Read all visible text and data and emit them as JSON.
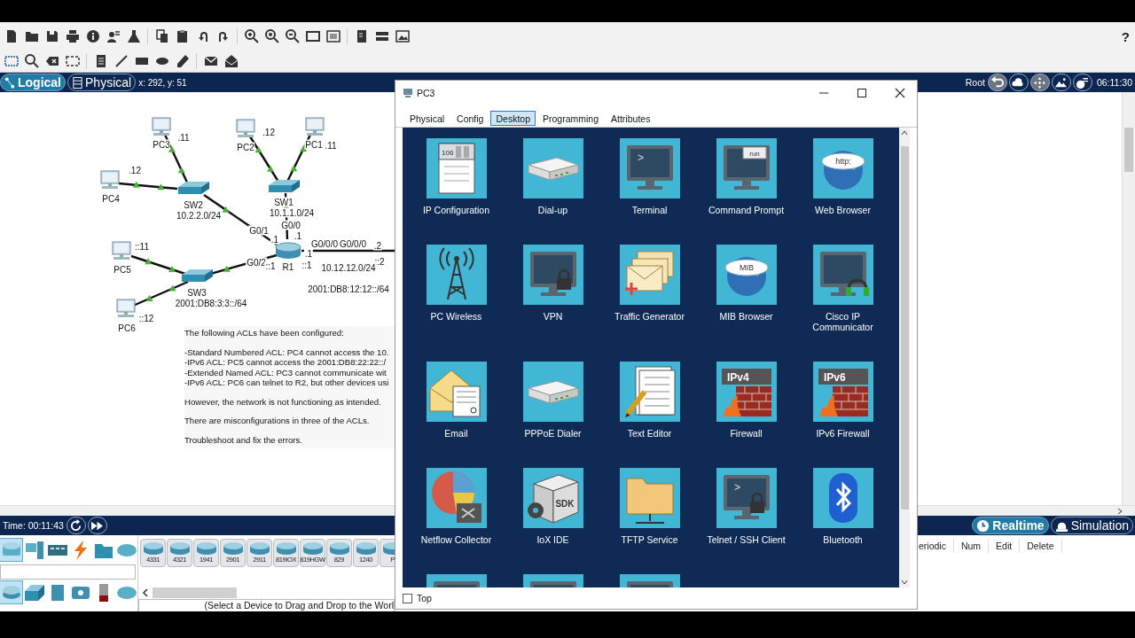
{
  "toolbar": {
    "help": "?"
  },
  "nav": {
    "tabs": [
      {
        "label": "Logical",
        "selected": true
      },
      {
        "label": "Physical",
        "selected": false
      }
    ],
    "coords": "x: 292, y: 51",
    "root": "Root",
    "clock": "06:11:30"
  },
  "topology": {
    "devices": [
      {
        "kind": "pc"
      },
      {
        "kind": "pc"
      },
      {
        "kind": "pc"
      },
      {
        "kind": "pc"
      },
      {
        "kind": "switch"
      },
      {
        "kind": "switch"
      },
      {
        "kind": "router"
      },
      {
        "kind": "pc"
      },
      {
        "kind": "switch"
      },
      {
        "kind": "pc"
      }
    ],
    "labels": [
      ".11",
      "PC3",
      ".12",
      "PC2",
      "PC1",
      ".11",
      ".12",
      "PC4",
      "SW2",
      "10.2.2.0/24",
      "SW1",
      "10.1.1.0/24",
      "G0/1",
      "G0/0",
      ".1",
      ".1",
      "G0/0/0",
      "G0/0/0",
      ".1",
      ".2",
      "G0/2",
      "::1",
      "R1",
      "::1",
      "::2",
      "10.12.12.0/24",
      "2001:DB8:12:12::/64",
      "::11",
      "PC5",
      "SW3",
      "2001:DB8:3:3::/64",
      "PC6",
      "::12"
    ]
  },
  "notes": [
    [
      "The following ACLs have been configured:"
    ],
    [
      "-Standard Numbered ACL: PC4 cannot access the 10.",
      "-IPv6 ACL: PC5 cannot access the 2001:DB8:22:22::/",
      "-Extended Named ACL: PC3 cannot communicate wit",
      "-IPv6 ACL: PC6 can telnet to R2, but other devices usi"
    ],
    [
      "However, the network is not functioning as intended."
    ],
    [
      "There are misconfigurations in three of the ACLs."
    ],
    [
      "Troubleshoot and fix the errors."
    ]
  ],
  "sim_bar": {
    "time": "Time: 00:11:43",
    "modes": [
      {
        "label": "Realtime",
        "selected": true
      },
      {
        "label": "Simulation",
        "selected": false
      }
    ]
  },
  "device_panel": {
    "categories_top": [
      {
        "selected": true
      },
      {
        "selected": false
      },
      {
        "selected": false
      },
      {
        "selected": false
      },
      {
        "selected": false
      },
      {
        "selected": false
      }
    ],
    "categories_bottom": [
      {
        "selected": true
      },
      {
        "selected": false
      },
      {
        "selected": false
      },
      {
        "selected": false
      },
      {
        "selected": false
      },
      {
        "selected": false
      }
    ],
    "models": [
      "4331",
      "4321",
      "1941",
      "2901",
      "2911",
      "819IOX",
      "819HGW",
      "829",
      "1240",
      "P"
    ],
    "hint": "(Select a Device to Drag and Drop to the Worl"
  },
  "scenario_table": {
    "columns": [
      "eriodic",
      "Num",
      "Edit",
      "Delete"
    ]
  },
  "window": {
    "title": "PC3",
    "tabs": [
      {
        "label": "Physical",
        "selected": false
      },
      {
        "label": "Config",
        "selected": false
      },
      {
        "label": "Desktop",
        "selected": true
      },
      {
        "label": "Programming",
        "selected": false
      },
      {
        "label": "Attributes",
        "selected": false
      }
    ],
    "apps": [
      {
        "label": "IP Configuration",
        "icon_text": "106"
      },
      {
        "label": "Dial-up"
      },
      {
        "label": "Terminal",
        "icon_text": ">"
      },
      {
        "label": "Command Prompt",
        "icon_text": "run"
      },
      {
        "label": "Web Browser",
        "icon_text": "http:"
      },
      {
        "label": "PC Wireless"
      },
      {
        "label": "VPN"
      },
      {
        "label": "Traffic Generator"
      },
      {
        "label": "MIB Browser",
        "icon_text": "MIB"
      },
      {
        "label": "Cisco IP Communicator"
      },
      {
        "label": "Email"
      },
      {
        "label": "PPPoE Dialer"
      },
      {
        "label": "Text Editor"
      },
      {
        "label": "Firewall",
        "icon_text": "IPv4"
      },
      {
        "label": "IPv6 Firewall",
        "icon_text": "IPv6"
      },
      {
        "label": "Netflow Collector"
      },
      {
        "label": "IoX IDE",
        "icon_text": "SDK"
      },
      {
        "label": "TFTP Service"
      },
      {
        "label": "Telnet / SSH Client",
        "icon_text": ">"
      },
      {
        "label": "Bluetooth"
      },
      {
        "partial": true
      },
      {
        "partial": true
      },
      {
        "partial": true
      }
    ],
    "top_checkbox": {
      "label": "Top",
      "checked": false
    }
  }
}
